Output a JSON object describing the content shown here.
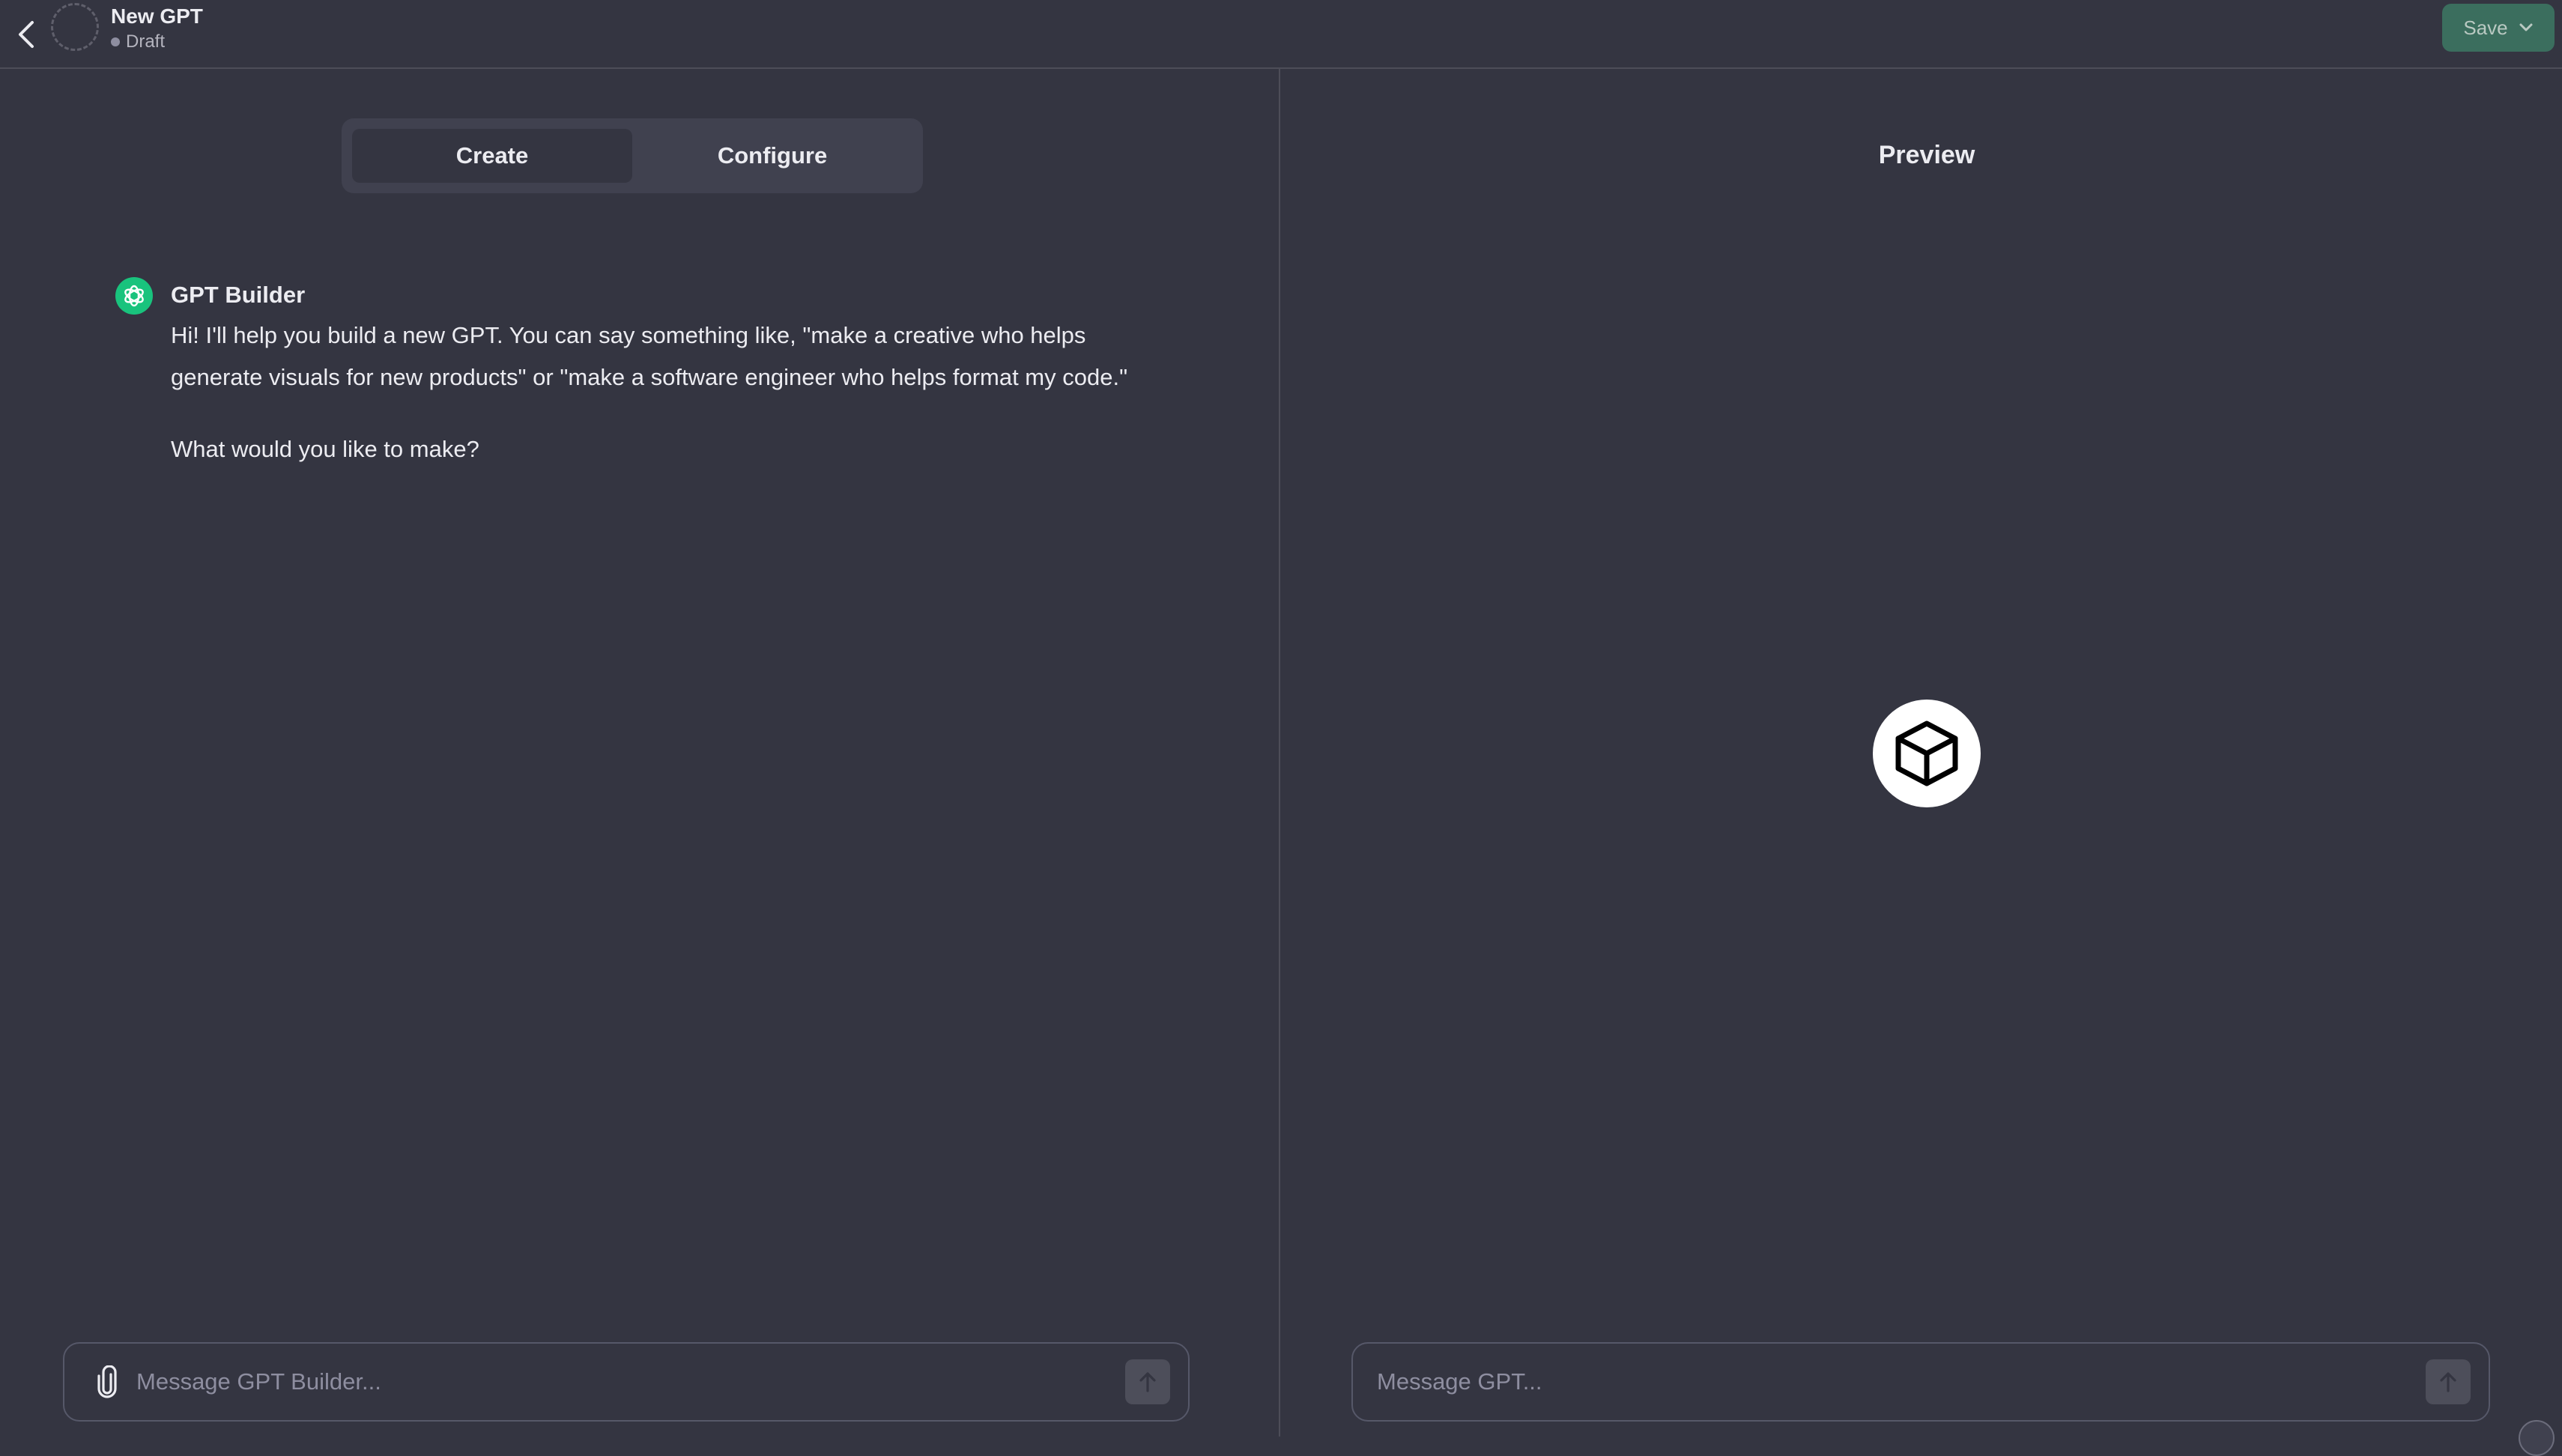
{
  "header": {
    "gpt_name": "New GPT",
    "status": "Draft",
    "save_label": "Save"
  },
  "builder": {
    "tabs": [
      {
        "label": "Create",
        "active": true
      },
      {
        "label": "Configure",
        "active": false
      }
    ],
    "message": {
      "author": "GPT Builder",
      "text": "Hi! I'll help you build a new GPT. You can say something like, \"make a creative who helps generate visuals for new products\" or \"make a software engineer who helps format my code.\"",
      "question": "What would you like to make?"
    },
    "composer_placeholder": "Message GPT Builder..."
  },
  "preview": {
    "title": "Preview",
    "icon": "cube-icon",
    "composer_placeholder": "Message GPT..."
  },
  "colors": {
    "background": "#343541",
    "save_button": "#3b6e5e",
    "builder_avatar": "#19c37d"
  }
}
